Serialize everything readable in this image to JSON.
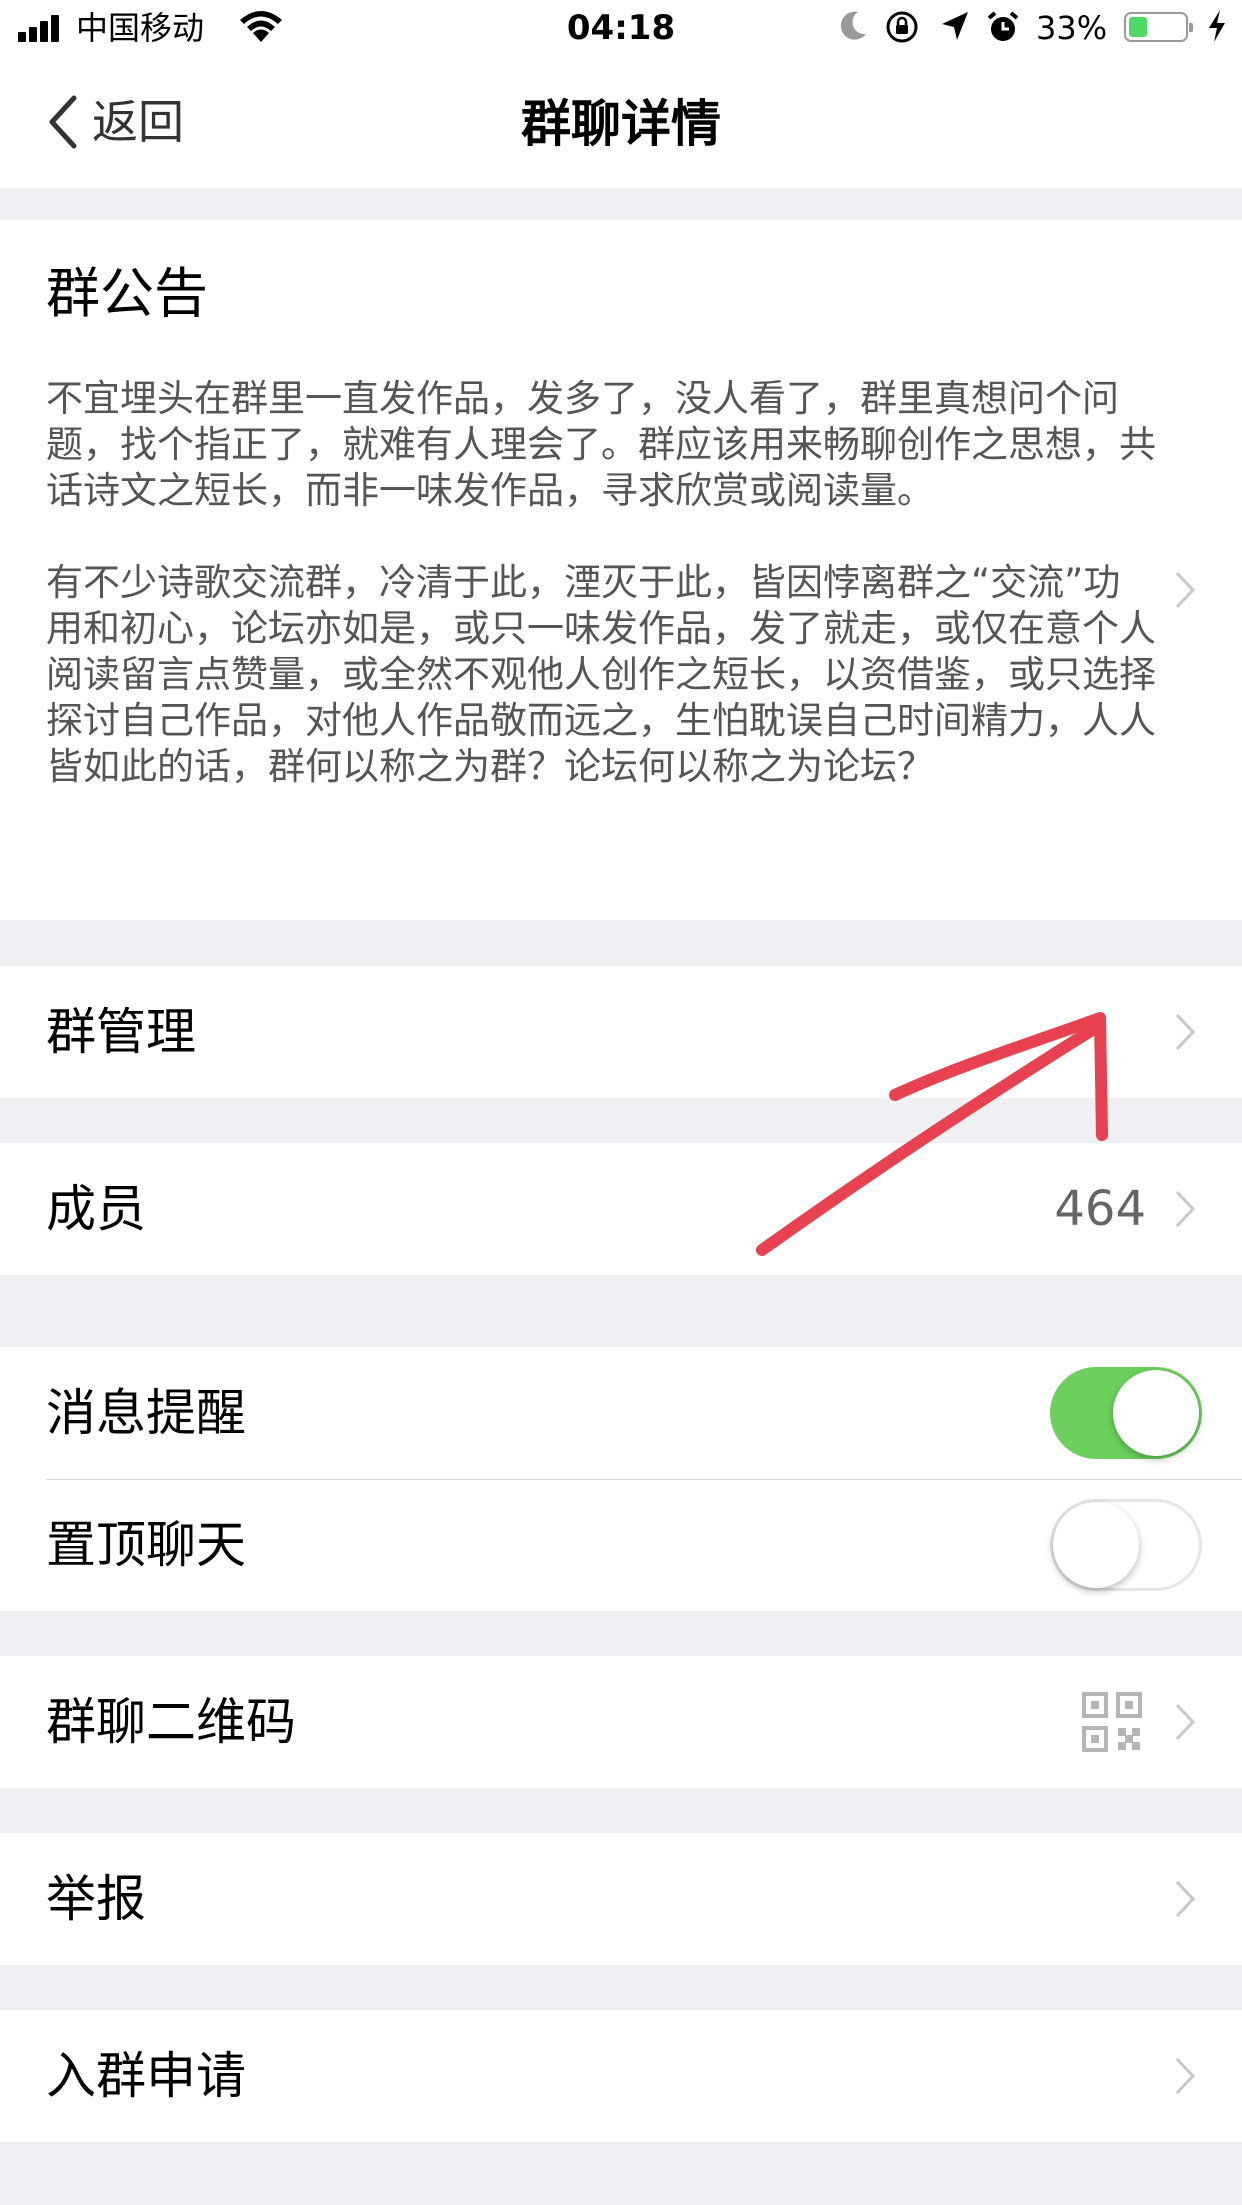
{
  "status_bar": {
    "carrier": "中国移动",
    "time": "04:18",
    "battery_percent": "33%",
    "battery_level": 0.33,
    "icons": [
      "signal-icon",
      "wifi-icon",
      "moon-icon",
      "rotation-lock-icon",
      "location-icon",
      "alarm-icon",
      "battery-icon",
      "charging-icon"
    ]
  },
  "nav": {
    "back_label": "返回",
    "title": "群聊详情"
  },
  "notice": {
    "title": "群公告",
    "text": "不宜埋头在群里一直发作品，发多了，没人看了，群里真想问个问题，找个指正了，就难有人理会了。群应该用来畅聊创作之思想，共话诗文之短长，而非一味发作品，寻求欣赏或阅读量。\n\n有不少诗歌交流群，冷清于此，湮灭于此，皆因悖离群之“交流”功用和初心，论坛亦如是，或只一味发作品，发了就走，或仅在意个人阅读留言点赞量，或全然不观他人创作之短长，以资借鉴，或只选择探讨自己作品，对他人作品敬而远之，生怕耽误自己时间精力，人人皆如此的话，群何以称之为群？论坛何以称之为论坛？"
  },
  "rows": {
    "group_manage": "群管理",
    "members": "成员",
    "members_count": "464",
    "message_alert": "消息提醒",
    "message_alert_on": true,
    "pin_chat": "置顶聊天",
    "pin_chat_on": false,
    "group_qr": "群聊二维码",
    "report": "举报",
    "join_request": "入群申请"
  },
  "colors": {
    "switch_on": "#6bd15c",
    "annotation_arrow": "#e8414f",
    "background": "#efeff4"
  }
}
